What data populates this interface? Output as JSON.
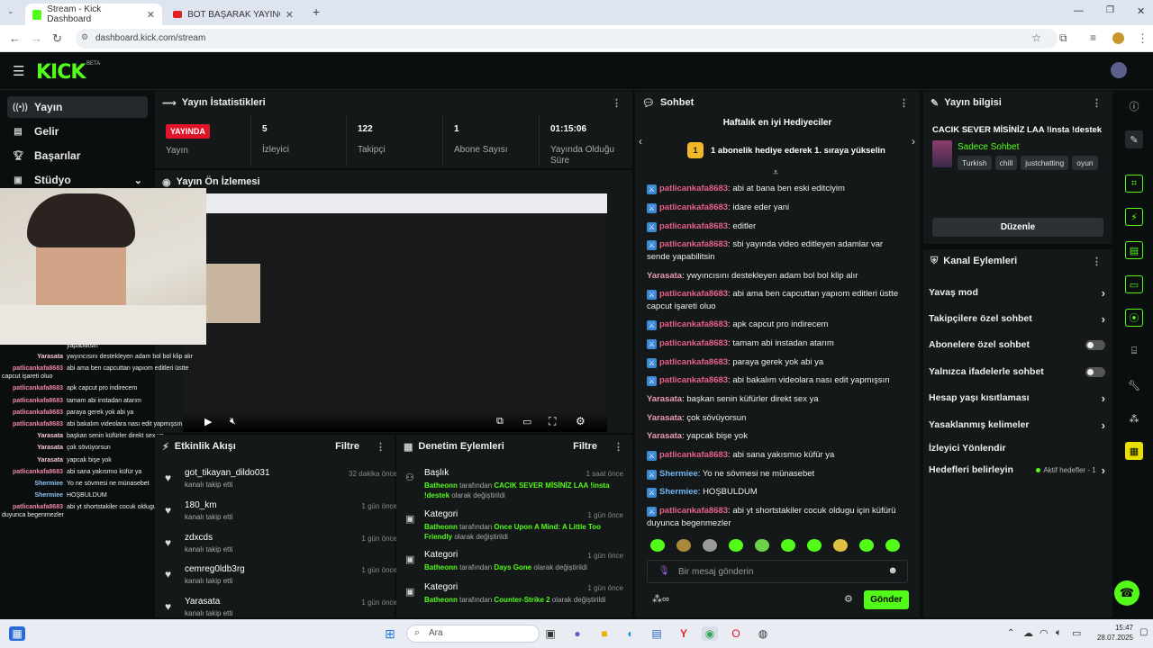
{
  "browser": {
    "tabs": [
      {
        "title": "Stream - Kick Dashboard",
        "active": true
      },
      {
        "title": "BOT BAŞARAK YAYINCI OLMAK",
        "active": false
      }
    ],
    "new_tab": "+",
    "url": "dashboard.kick.com/stream"
  },
  "brand": {
    "logo": "KICK",
    "badge": "BETA",
    "accent": "#53fc18"
  },
  "sidebar": {
    "items": [
      {
        "label": "Yayın",
        "icon": "broadcast-icon",
        "selected": true
      },
      {
        "label": "Gelir",
        "icon": "revenue-icon"
      },
      {
        "label": "Başarılar",
        "icon": "trophy-icon"
      },
      {
        "label": "Stüdyo",
        "icon": "studio-icon"
      }
    ]
  },
  "stats": {
    "title": "Yayın İstatistikleri",
    "live_badge": "YAYINDA",
    "items": [
      {
        "value": "",
        "label": "Yayın"
      },
      {
        "value": "5",
        "label": "İzleyici"
      },
      {
        "value": "122",
        "label": "Takipçi"
      },
      {
        "value": "1",
        "label": "Abone Sayısı"
      },
      {
        "value": "01:15:06",
        "label": "Yayında Olduğu Süre"
      }
    ]
  },
  "preview": {
    "title": "Yayın Ön İzlemesi"
  },
  "activity": {
    "title": "Etkinlik Akışı",
    "filter": "Filtre",
    "items": [
      {
        "name": "got_tikayan_dildo031",
        "sub": "kanalı takip etti",
        "time": "32 dakika önce"
      },
      {
        "name": "180_km",
        "sub": "kanalı takip etti",
        "time": "1 gün önce"
      },
      {
        "name": "zdxcds",
        "sub": "kanalı takip etti",
        "time": "1 gün önce"
      },
      {
        "name": "cemreg0ldb3rg",
        "sub": "kanalı takip etti",
        "time": "1 gün önce"
      },
      {
        "name": "Yarasata",
        "sub": "kanalı takip etti",
        "time": "1 gün önce"
      }
    ]
  },
  "moderation": {
    "title": "Denetim Eylemleri",
    "filter": "Filtre",
    "items": [
      {
        "type": "Başlık",
        "time": "1 saat önce",
        "user": "Batheonn",
        "mid": "tarafından",
        "value": "CACIK SEVER MİSİNİZ LAA !insta !destek",
        "end": "olarak değiştirildi"
      },
      {
        "type": "Kategori",
        "time": "1 gün önce",
        "user": "Batheonn",
        "mid": "tarafından",
        "value": "Once Upon A Mind: A Little Too Friendly",
        "end": "olarak değiştirildi"
      },
      {
        "type": "Kategori",
        "time": "1 gün önce",
        "user": "Batheonn",
        "mid": "tarafından",
        "value": "Days Gone",
        "end": "olarak değiştirildi"
      },
      {
        "type": "Kategori",
        "time": "1 gün önce",
        "user": "Batheonn",
        "mid": "tarafından",
        "value": "Counter-Strike 2",
        "end": "olarak değiştirildi"
      }
    ]
  },
  "chat": {
    "title": "Sohbet",
    "gifters_title": "Haftalık en iyi Hediyeciler",
    "gifters_rank": "1",
    "gifters_text": "1 abonelik hediye ederek 1. sıraya yükselin",
    "messages": [
      {
        "user": "patlicankafa8683",
        "badge": true,
        "text": "abi at bana ben eski editciyim"
      },
      {
        "user": "patlicankafa8683",
        "badge": true,
        "text": "idare eder yani"
      },
      {
        "user": "patlicankafa8683",
        "badge": true,
        "text": "editler"
      },
      {
        "user": "patlicankafa8683",
        "badge": true,
        "text": "sbi yayında video editleyen adamlar var sende yapabilitsin"
      },
      {
        "user": "Yarasata",
        "badge": false,
        "text": "ywyıncısını destekleyen adam bol bol klip alır"
      },
      {
        "user": "patlicankafa8683",
        "badge": true,
        "text": "abi ama ben capcuttan yapıom editleri üstte capcut işareti oluo"
      },
      {
        "user": "patlicankafa8683",
        "badge": true,
        "text": "apk capcut pro indirecem"
      },
      {
        "user": "patlicankafa8683",
        "badge": true,
        "text": "tamam abi instadan atarım"
      },
      {
        "user": "patlicankafa8683",
        "badge": true,
        "text": "paraya gerek yok abi ya"
      },
      {
        "user": "patlicankafa8683",
        "badge": true,
        "text": "abi bakalım videolara nası edit yapmışsın"
      },
      {
        "user": "Yarasata",
        "badge": false,
        "text": "başkan senin küfürler direkt sex ya"
      },
      {
        "user": "Yarasata",
        "badge": false,
        "text": "çok sövüyorsun"
      },
      {
        "user": "Yarasata",
        "badge": false,
        "text": "yapcak bişe yok"
      },
      {
        "user": "patlicankafa8683",
        "badge": true,
        "text": "abi sana yakısmıo küfür ya"
      },
      {
        "user": "Shermiee",
        "badge": true,
        "text": "Yo ne sövmesi ne münasebet"
      },
      {
        "user": "Shermiee",
        "badge": true,
        "text": "HOŞBULDUM"
      },
      {
        "user": "patlicankafa8683",
        "badge": true,
        "text": "abi yt shortstakiler cocuk oldugu için küfürü duyunca begenmezler"
      }
    ],
    "input_placeholder": "Bir mesaj gönderin",
    "send": "Gönder"
  },
  "stream_info": {
    "title": "Yayın bilgisi",
    "stream_title": "CACIK SEVER MİSİNİZ LAA !insta !destek",
    "chat_mode": "Sadece Sohbet",
    "tags": [
      "Turkish",
      "chill",
      "justchatting",
      "oyun"
    ],
    "edit": "Düzenle"
  },
  "channel_actions": {
    "title": "Kanal Eylemleri",
    "items": [
      {
        "label": "Yavaş mod",
        "control": "chevron"
      },
      {
        "label": "Takipçilere özel sohbet",
        "control": "chevron"
      },
      {
        "label": "Abonelere özel sohbet",
        "control": "toggle",
        "on": false
      },
      {
        "label": "Yalnızca ifadelerle sohbet",
        "control": "toggle",
        "on": false
      },
      {
        "label": "Hesap yaşı kısıtlaması",
        "control": "chevron"
      },
      {
        "label": "Yasaklanmış kelimeler",
        "control": "chevron"
      },
      {
        "label": "İzleyici Yönlendir",
        "control": "none"
      },
      {
        "label": "Hedefleri belirleyin",
        "control": "chevron",
        "status": "Aktif hedefler - 1"
      }
    ]
  },
  "overlay_chat": [
    {
      "user": "",
      "text": "yapabilitsin"
    },
    {
      "user": "Yarasata",
      "text": "ywyıncısını destekleyen adam bol bol klip alır"
    },
    {
      "user": "patlicankafa8683",
      "text": "abi ama ben capcuttan yapıom editleri üstte capcut işareti oluo"
    },
    {
      "user": "patlicankafa8683",
      "text": "apk capcut pro indirecem"
    },
    {
      "user": "patlicankafa8683",
      "text": "tamam abi instadan atarım"
    },
    {
      "user": "patlicankafa8683",
      "text": "paraya gerek yok abi ya"
    },
    {
      "user": "patlicankafa8683",
      "text": "abi bakalım videolara nası edit yapmışsın"
    },
    {
      "user": "Yarasata",
      "text": "başkan senin küfürler direkt sex ya"
    },
    {
      "user": "Yarasata",
      "text": "çok sövüyorsun"
    },
    {
      "user": "Yarasata",
      "text": "yapcak bişe yok"
    },
    {
      "user": "patlicankafa8683",
      "text": "abi sana yakısmıo küfür ya"
    },
    {
      "user": "Shermiee",
      "text": "Yo ne sövmesi ne münasebet"
    },
    {
      "user": "Shermiee",
      "text": "HOŞBULDUM"
    },
    {
      "user": "patlicankafa8683",
      "text": "abi yt shortstakiler cocuk oldugu için küfürü duyunca begenmezler"
    }
  ],
  "taskbar": {
    "search": "Ara",
    "time": "15:47",
    "date": "28.07.2025"
  }
}
